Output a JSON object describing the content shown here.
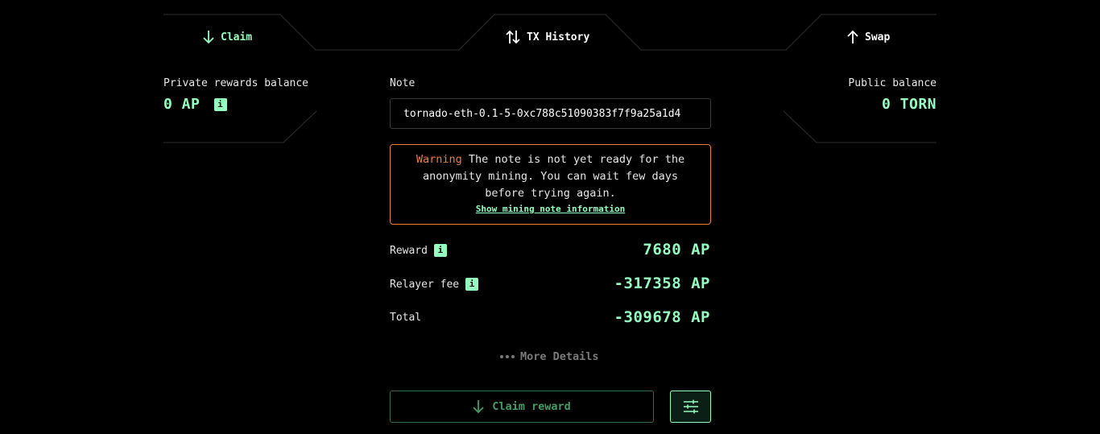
{
  "tabs": {
    "claim": "Claim",
    "history": "TX History",
    "swap": "Swap"
  },
  "private_balance": {
    "label": "Private rewards balance",
    "value": "0 AP",
    "info": "i"
  },
  "public_balance": {
    "label": "Public balance",
    "value": "0 TORN"
  },
  "note": {
    "label": "Note",
    "value": "tornado-eth-0.1-5-0xc788c51090383f7f9a25a1d4"
  },
  "warning": {
    "title": "Warning",
    "message": "The note is not yet ready for the anonymity mining. You can wait few days before trying again.",
    "link": "Show mining note information"
  },
  "summary": {
    "reward_label": "Reward",
    "reward_value": "7680 AP",
    "fee_label": "Relayer fee",
    "fee_value": "-317358 AP",
    "total_label": "Total",
    "total_value": "-309678 AP",
    "info": "i"
  },
  "more_details": "More Details",
  "claim_button": "Claim reward",
  "colors": {
    "accent": "#94febf",
    "warning": "#f07a38",
    "background": "#000000"
  }
}
